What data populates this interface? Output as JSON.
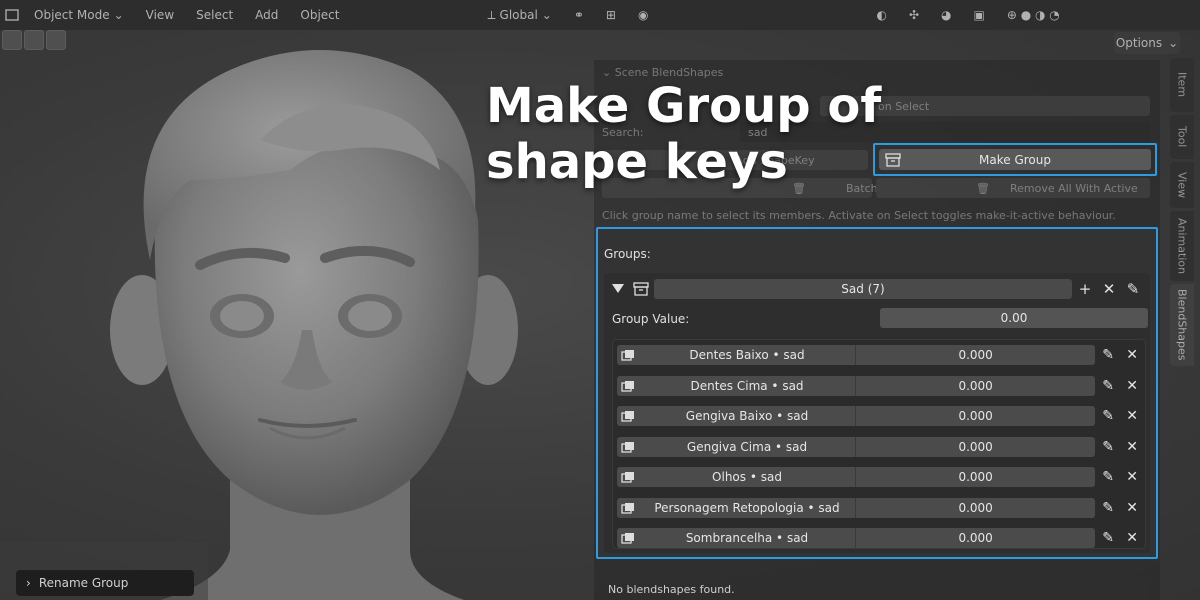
{
  "header": {
    "mode": "Object Mode",
    "menus": [
      "View",
      "Select",
      "Add",
      "Object"
    ],
    "orientation": "Global"
  },
  "options_label": "Options",
  "side_tabs": [
    "Item",
    "Tool",
    "View",
    "Animation",
    "BlendShapes"
  ],
  "panel": {
    "title": "Scene BlendShapes",
    "activate_on_select": "on Select",
    "search_label": "Search:",
    "search_value": "sad",
    "add_shapekey_label": "Add ShapeKey",
    "make_group_label": "Make Group",
    "batch_remove_label": "Batch Remove",
    "remove_all_label": "Remove All With Active",
    "hint": "Click group name to select its members. Activate on Select toggles make-it-active behaviour."
  },
  "overlay_title": [
    "Make Group of",
    "shape keys"
  ],
  "groups": {
    "label": "Groups:",
    "group_name": "Sad (7)",
    "group_value_label": "Group Value:",
    "group_value": "0.00",
    "members": [
      {
        "name": "Dentes Baixo • sad",
        "value": "0.000"
      },
      {
        "name": "Dentes Cima • sad",
        "value": "0.000"
      },
      {
        "name": "Gengiva Baixo • sad",
        "value": "0.000"
      },
      {
        "name": "Gengiva Cima • sad",
        "value": "0.000"
      },
      {
        "name": "Olhos • sad",
        "value": "0.000"
      },
      {
        "name": "Personagem Retopologia • sad",
        "value": "0.000"
      },
      {
        "name": "Sombrancelha • sad",
        "value": "0.000"
      }
    ]
  },
  "no_blendshapes": "No blendshapes found.",
  "rename_group_label": "Rename Group",
  "colors": {
    "highlight": "#2e9ae0",
    "panel": "#333333",
    "field": "#4b4b4b"
  }
}
